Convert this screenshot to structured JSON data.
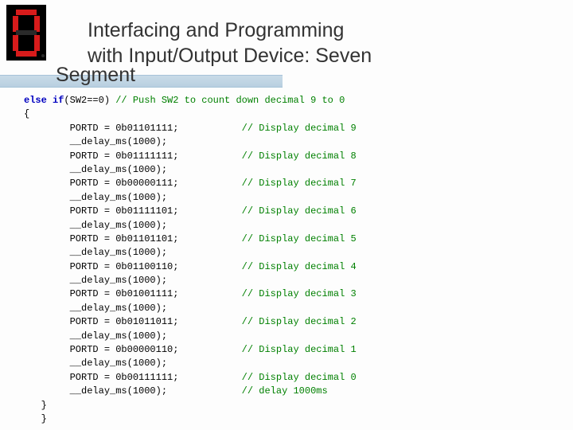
{
  "title_line1": "Interfacing and Programming",
  "title_line2": "with Input/Output Device: Seven",
  "title_line3": "Segment",
  "code": {
    "head_kw": "else if",
    "head_cond": "(SW2==0)",
    "head_cm": " // Push SW2 to count down decimal 9 to 0",
    "open": "{",
    "lines": [
      {
        "a": "        PORTD = 0b01101111;",
        "c": "// Display decimal 9"
      },
      {
        "a": "        __delay_ms(1000);",
        "c": ""
      },
      {
        "a": "        PORTD = 0b01111111;",
        "c": "// Display decimal 8"
      },
      {
        "a": "        __delay_ms(1000);",
        "c": ""
      },
      {
        "a": "        PORTD = 0b00000111;",
        "c": "// Display decimal 7"
      },
      {
        "a": "        __delay_ms(1000);",
        "c": ""
      },
      {
        "a": "        PORTD = 0b01111101;",
        "c": "// Display decimal 6"
      },
      {
        "a": "        __delay_ms(1000);",
        "c": ""
      },
      {
        "a": "        PORTD = 0b01101101;",
        "c": "// Display decimal 5"
      },
      {
        "a": "        __delay_ms(1000);",
        "c": ""
      },
      {
        "a": "        PORTD = 0b01100110;",
        "c": "// Display decimal 4"
      },
      {
        "a": "        __delay_ms(1000);",
        "c": ""
      },
      {
        "a": "        PORTD = 0b01001111;",
        "c": "// Display decimal 3"
      },
      {
        "a": "        __delay_ms(1000);",
        "c": ""
      },
      {
        "a": "        PORTD = 0b01011011;",
        "c": "// Display decimal 2"
      },
      {
        "a": "        __delay_ms(1000);",
        "c": ""
      },
      {
        "a": "        PORTD = 0b00000110;",
        "c": "// Display decimal 1"
      },
      {
        "a": "        __delay_ms(1000);",
        "c": ""
      },
      {
        "a": "        PORTD = 0b00111111;",
        "c": "// Display decimal 0"
      },
      {
        "a": "        __delay_ms(1000);",
        "c": "// delay 1000ms"
      }
    ],
    "close1": "   }",
    "close2": "   }"
  }
}
